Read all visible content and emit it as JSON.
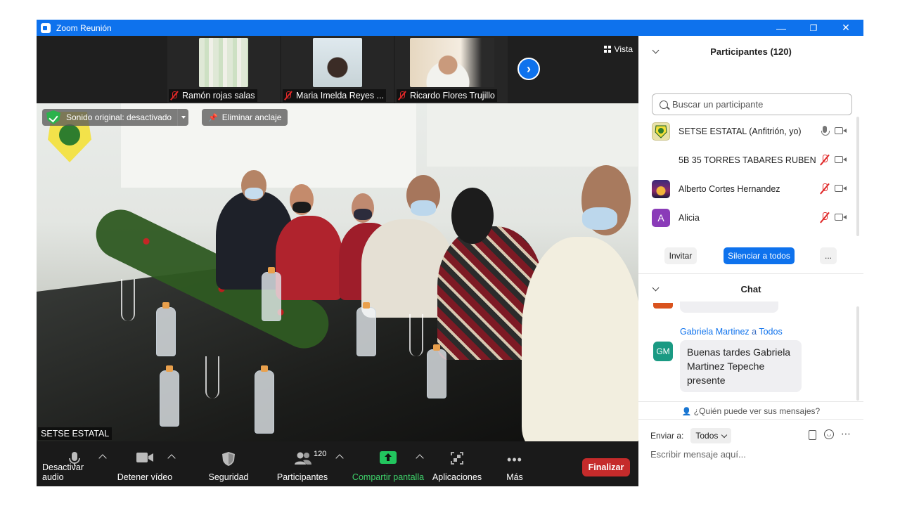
{
  "window": {
    "title": "Zoom Reunión",
    "minimize": "—",
    "restore": "❐",
    "close": "✕"
  },
  "strip": {
    "thumbnails": [
      {
        "name": "Ramón rojas salas"
      },
      {
        "name": "Maria Imelda Reyes ..."
      },
      {
        "name": "Ricardo Flores Trujillo"
      }
    ],
    "next": "›",
    "view_label": "Vista"
  },
  "main_video": {
    "original_sound": "Sonido original: desactivado",
    "unpin": "Eliminar anclaje",
    "speaker": "SETSE ESTATAL"
  },
  "toolbar": {
    "mute": "Desactivar audio",
    "stop_video": "Detener vídeo",
    "security": "Seguridad",
    "participants": "Participantes",
    "participant_count": "120",
    "share": "Compartir pantalla",
    "apps": "Aplicaciones",
    "more": "Más",
    "end": "Finalizar"
  },
  "participants_panel": {
    "title": "Participantes (120)",
    "search_placeholder": "Buscar un participante",
    "list": [
      {
        "name": "SETSE ESTATAL (Anfitrión, yo)",
        "avatar": "",
        "mic": "on"
      },
      {
        "name": "5B 35 TORRES TABARES RUBEN ...",
        "avatar": "",
        "mic": "muted"
      },
      {
        "name": "Alberto Cortes Hernandez",
        "avatar": "",
        "mic": "muted"
      },
      {
        "name": "Alicia",
        "avatar": "A",
        "mic": "muted"
      }
    ],
    "invite": "Invitar",
    "mute_all": "Silenciar a todos",
    "more": "..."
  },
  "chat": {
    "title": "Chat",
    "sender": "Gabriela Martinez",
    "to_word": "a",
    "recipient": "Todos",
    "initials": "GM",
    "message": "Buenas tardes Gabriela Martinez Tepeche presente",
    "who_can_see": "¿Quién puede ver sus mensajes?",
    "send_to_label": "Enviar a:",
    "send_to_value": "Todos",
    "input_placeholder": "Escribir mensaje aquí..."
  },
  "colors": {
    "accent": "#0e72ed",
    "end": "#c52b2b",
    "share": "#22c55e",
    "muted": "#e02828"
  }
}
